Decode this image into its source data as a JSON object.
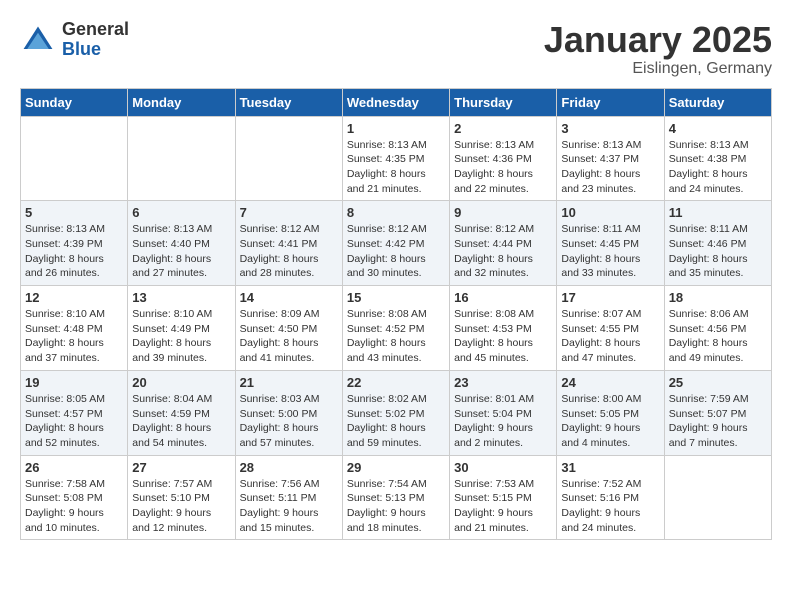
{
  "logo": {
    "general": "General",
    "blue": "Blue"
  },
  "title": "January 2025",
  "location": "Eislingen, Germany",
  "days_of_week": [
    "Sunday",
    "Monday",
    "Tuesday",
    "Wednesday",
    "Thursday",
    "Friday",
    "Saturday"
  ],
  "weeks": [
    [
      {
        "day": "",
        "content": ""
      },
      {
        "day": "",
        "content": ""
      },
      {
        "day": "",
        "content": ""
      },
      {
        "day": "1",
        "content": "Sunrise: 8:13 AM\nSunset: 4:35 PM\nDaylight: 8 hours and 21 minutes."
      },
      {
        "day": "2",
        "content": "Sunrise: 8:13 AM\nSunset: 4:36 PM\nDaylight: 8 hours and 22 minutes."
      },
      {
        "day": "3",
        "content": "Sunrise: 8:13 AM\nSunset: 4:37 PM\nDaylight: 8 hours and 23 minutes."
      },
      {
        "day": "4",
        "content": "Sunrise: 8:13 AM\nSunset: 4:38 PM\nDaylight: 8 hours and 24 minutes."
      }
    ],
    [
      {
        "day": "5",
        "content": "Sunrise: 8:13 AM\nSunset: 4:39 PM\nDaylight: 8 hours and 26 minutes."
      },
      {
        "day": "6",
        "content": "Sunrise: 8:13 AM\nSunset: 4:40 PM\nDaylight: 8 hours and 27 minutes."
      },
      {
        "day": "7",
        "content": "Sunrise: 8:12 AM\nSunset: 4:41 PM\nDaylight: 8 hours and 28 minutes."
      },
      {
        "day": "8",
        "content": "Sunrise: 8:12 AM\nSunset: 4:42 PM\nDaylight: 8 hours and 30 minutes."
      },
      {
        "day": "9",
        "content": "Sunrise: 8:12 AM\nSunset: 4:44 PM\nDaylight: 8 hours and 32 minutes."
      },
      {
        "day": "10",
        "content": "Sunrise: 8:11 AM\nSunset: 4:45 PM\nDaylight: 8 hours and 33 minutes."
      },
      {
        "day": "11",
        "content": "Sunrise: 8:11 AM\nSunset: 4:46 PM\nDaylight: 8 hours and 35 minutes."
      }
    ],
    [
      {
        "day": "12",
        "content": "Sunrise: 8:10 AM\nSunset: 4:48 PM\nDaylight: 8 hours and 37 minutes."
      },
      {
        "day": "13",
        "content": "Sunrise: 8:10 AM\nSunset: 4:49 PM\nDaylight: 8 hours and 39 minutes."
      },
      {
        "day": "14",
        "content": "Sunrise: 8:09 AM\nSunset: 4:50 PM\nDaylight: 8 hours and 41 minutes."
      },
      {
        "day": "15",
        "content": "Sunrise: 8:08 AM\nSunset: 4:52 PM\nDaylight: 8 hours and 43 minutes."
      },
      {
        "day": "16",
        "content": "Sunrise: 8:08 AM\nSunset: 4:53 PM\nDaylight: 8 hours and 45 minutes."
      },
      {
        "day": "17",
        "content": "Sunrise: 8:07 AM\nSunset: 4:55 PM\nDaylight: 8 hours and 47 minutes."
      },
      {
        "day": "18",
        "content": "Sunrise: 8:06 AM\nSunset: 4:56 PM\nDaylight: 8 hours and 49 minutes."
      }
    ],
    [
      {
        "day": "19",
        "content": "Sunrise: 8:05 AM\nSunset: 4:57 PM\nDaylight: 8 hours and 52 minutes."
      },
      {
        "day": "20",
        "content": "Sunrise: 8:04 AM\nSunset: 4:59 PM\nDaylight: 8 hours and 54 minutes."
      },
      {
        "day": "21",
        "content": "Sunrise: 8:03 AM\nSunset: 5:00 PM\nDaylight: 8 hours and 57 minutes."
      },
      {
        "day": "22",
        "content": "Sunrise: 8:02 AM\nSunset: 5:02 PM\nDaylight: 8 hours and 59 minutes."
      },
      {
        "day": "23",
        "content": "Sunrise: 8:01 AM\nSunset: 5:04 PM\nDaylight: 9 hours and 2 minutes."
      },
      {
        "day": "24",
        "content": "Sunrise: 8:00 AM\nSunset: 5:05 PM\nDaylight: 9 hours and 4 minutes."
      },
      {
        "day": "25",
        "content": "Sunrise: 7:59 AM\nSunset: 5:07 PM\nDaylight: 9 hours and 7 minutes."
      }
    ],
    [
      {
        "day": "26",
        "content": "Sunrise: 7:58 AM\nSunset: 5:08 PM\nDaylight: 9 hours and 10 minutes."
      },
      {
        "day": "27",
        "content": "Sunrise: 7:57 AM\nSunset: 5:10 PM\nDaylight: 9 hours and 12 minutes."
      },
      {
        "day": "28",
        "content": "Sunrise: 7:56 AM\nSunset: 5:11 PM\nDaylight: 9 hours and 15 minutes."
      },
      {
        "day": "29",
        "content": "Sunrise: 7:54 AM\nSunset: 5:13 PM\nDaylight: 9 hours and 18 minutes."
      },
      {
        "day": "30",
        "content": "Sunrise: 7:53 AM\nSunset: 5:15 PM\nDaylight: 9 hours and 21 minutes."
      },
      {
        "day": "31",
        "content": "Sunrise: 7:52 AM\nSunset: 5:16 PM\nDaylight: 9 hours and 24 minutes."
      },
      {
        "day": "",
        "content": ""
      }
    ]
  ]
}
